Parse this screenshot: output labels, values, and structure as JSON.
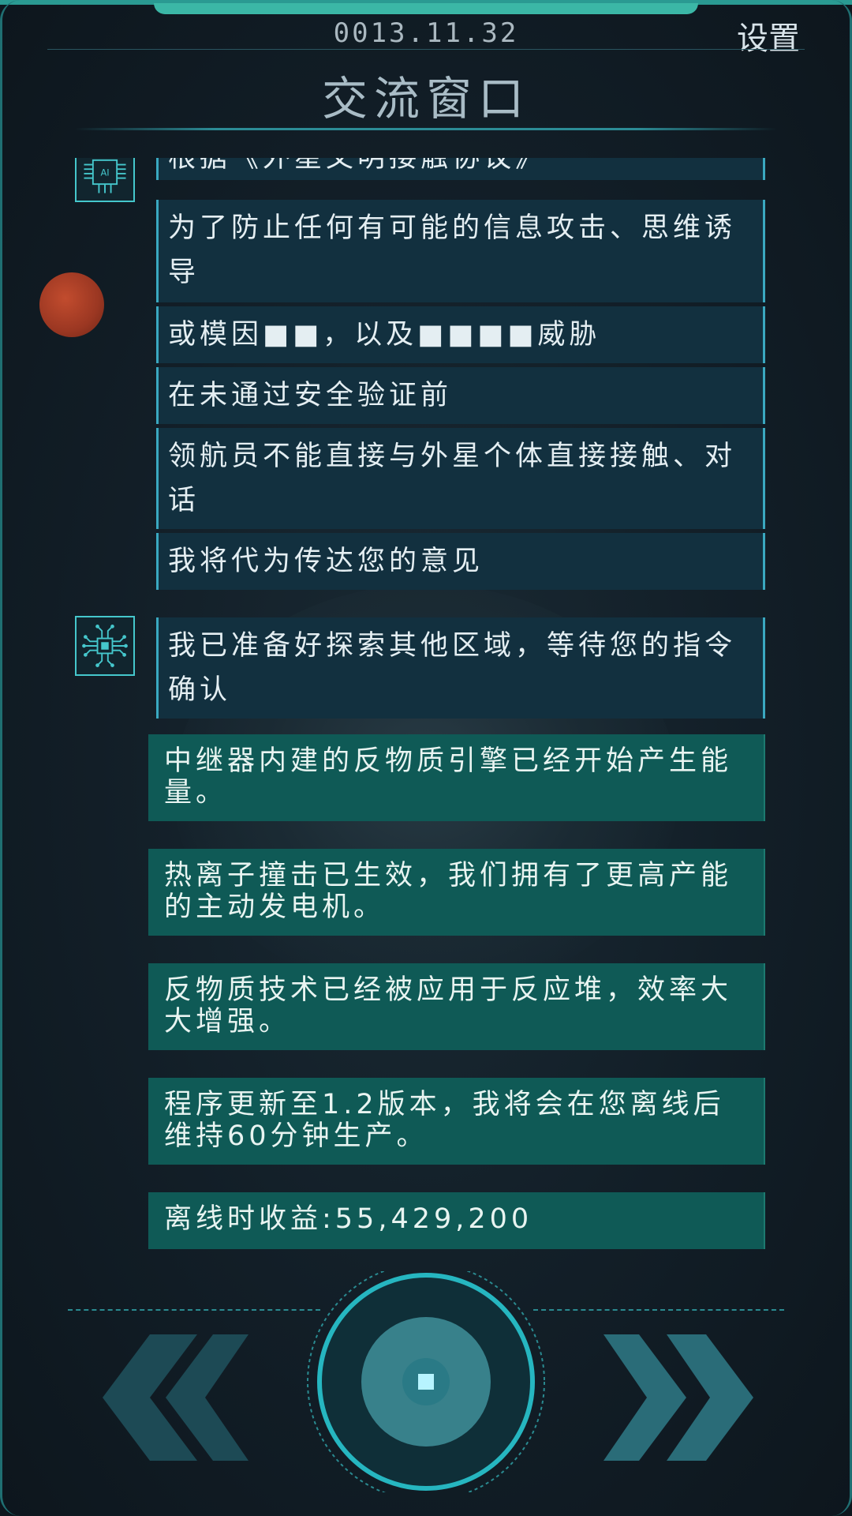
{
  "header": {
    "date": "0013.11.32",
    "settings_label": "设置",
    "title": "交流窗口"
  },
  "messages": {
    "partial_top": "根据《外星文明接触协议》",
    "ai_lines": [
      "为了防止任何有可能的信息攻击、思维诱导",
      "或模因■■，以及■■■■威胁",
      "在未通过安全验证前",
      "领航员不能直接与外星个体直接接触、对话",
      "我将代为传达您的意见"
    ],
    "chip_message": "我已准备好探索其他区域，等待您的指令确认",
    "system_messages": [
      "中继器内建的反物质引擎已经开始产生能量。",
      "热离子撞击已生效，我们拥有了更高产能的主动发电机。",
      "反物质技术已经被应用于反应堆，效率大大增强。",
      "程序更新至1.2版本，我将会在您离线后维持60分钟生产。",
      "离线时收益:55,429,200"
    ]
  },
  "icons": {
    "ai_avatar": "ai-chip-avatar-icon",
    "chip_avatar": "circuit-chip-avatar-icon",
    "planet": "planet-icon",
    "prev": "double-chevron-left-icon",
    "next": "double-chevron-right-icon",
    "center": "stop-button-icon"
  },
  "colors": {
    "accent": "#45c7cc",
    "ai_bubble": "#12303f",
    "system_bubble": "#0f5a56",
    "background": "#121e27"
  }
}
